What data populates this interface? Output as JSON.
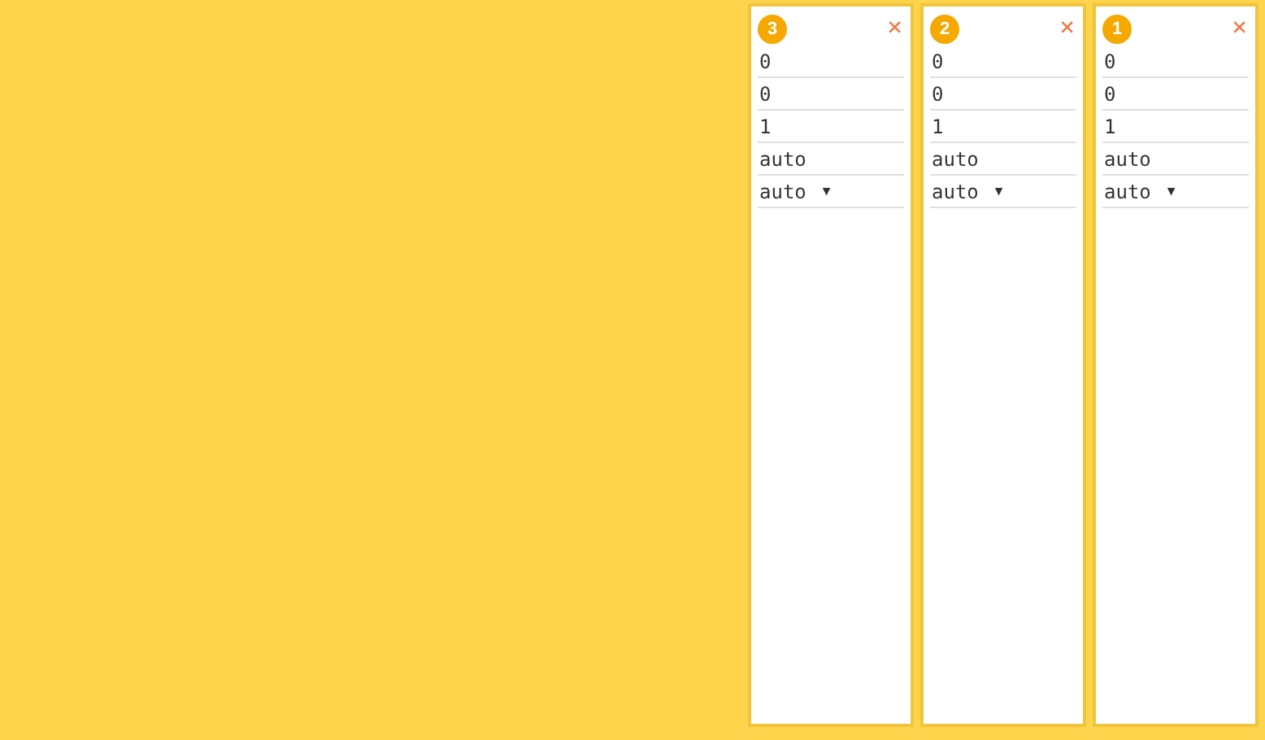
{
  "panels": [
    {
      "badge": "3",
      "close": "×",
      "fields": [
        {
          "kind": "input",
          "value": "0"
        },
        {
          "kind": "input",
          "value": "0"
        },
        {
          "kind": "input",
          "value": "1"
        },
        {
          "kind": "input",
          "value": "auto"
        },
        {
          "kind": "select",
          "value": "auto",
          "caret": "▼"
        }
      ]
    },
    {
      "badge": "2",
      "close": "×",
      "fields": [
        {
          "kind": "input",
          "value": "0"
        },
        {
          "kind": "input",
          "value": "0"
        },
        {
          "kind": "input",
          "value": "1"
        },
        {
          "kind": "input",
          "value": "auto"
        },
        {
          "kind": "select",
          "value": "auto",
          "caret": "▼"
        }
      ]
    },
    {
      "badge": "1",
      "close": "×",
      "fields": [
        {
          "kind": "input",
          "value": "0"
        },
        {
          "kind": "input",
          "value": "0"
        },
        {
          "kind": "input",
          "value": "1"
        },
        {
          "kind": "input",
          "value": "auto"
        },
        {
          "kind": "select",
          "value": "auto",
          "caret": "▼"
        }
      ]
    }
  ]
}
